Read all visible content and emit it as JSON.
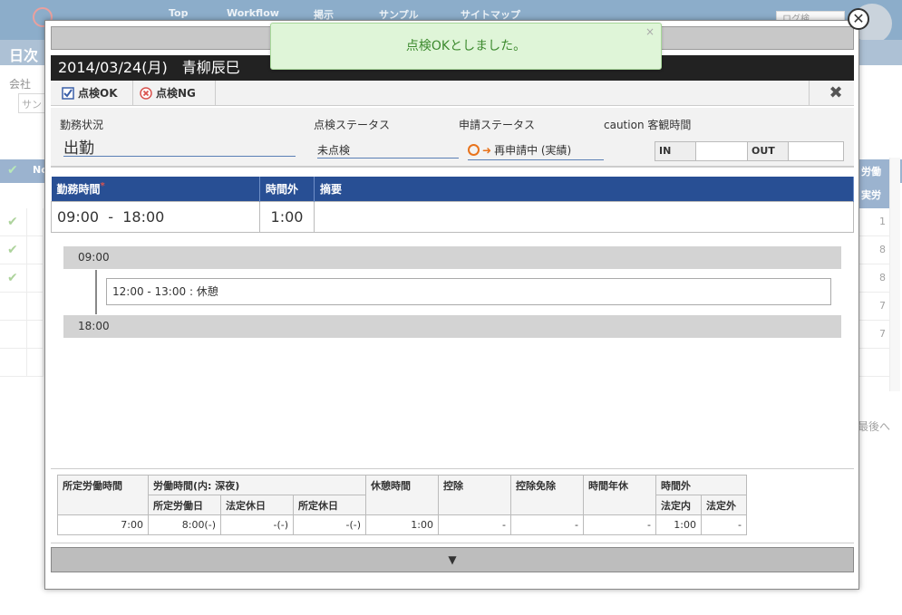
{
  "background": {
    "nav_items": [
      "Top",
      "Workflow",
      "掲示",
      "サンプル",
      "サイトマップ"
    ],
    "search_label": "ログ検",
    "page_title": "日次",
    "company_label": "会社",
    "company_value": "サン",
    "table_no_header": "No",
    "right_header_1": "労働",
    "right_header_2": "実労",
    "right_values": [
      "1",
      "8",
      "8",
      "7",
      "7",
      ""
    ],
    "last_link": "最後へ"
  },
  "toast": {
    "message": "点検OKとしました。",
    "close_label": "×"
  },
  "modal": {
    "title": "2014/03/24(月)　青柳辰巳",
    "toolbar": {
      "ok_label": "点検OK",
      "ng_label": "点検NG",
      "close_label": "✖"
    },
    "status": {
      "work_status_label": "勤務状況",
      "work_status_value": "出勤",
      "inspect_status_label": "点検ステータス",
      "inspect_status_value": "未点検",
      "apply_status_label": "申請ステータス",
      "apply_status_value": "再申請中 (実績)",
      "objective_time_label": "caution 客観時間",
      "in_label": "IN",
      "in_value": "",
      "out_label": "OUT",
      "out_value": ""
    },
    "worktime": {
      "col_worktime": "勤務時間",
      "required_mark": "*",
      "col_overtime": "時間外",
      "col_summary": "摘要",
      "start": "09:00",
      "sep": "-",
      "end": "18:00",
      "overtime": "1:00",
      "summary": ""
    },
    "timeline": {
      "start": "09:00",
      "break": "12:00 - 13:00 : 休憩",
      "end": "18:00"
    },
    "summary": {
      "h_scheduled": "所定労働時間",
      "h_worktime": "労働時間(内: 深夜)",
      "h_sched_day": "所定労働日",
      "h_legal_holiday": "法定休日",
      "h_sched_holiday": "所定休日",
      "h_break": "休憩時間",
      "h_deduct": "控除",
      "h_deduct_exempt": "控除免除",
      "h_hourly_leave": "時間年休",
      "h_overtime": "時間外",
      "h_legal_in": "法定内",
      "h_legal_out": "法定外",
      "v_scheduled": "7:00",
      "v_sched_day": "8:00(-)",
      "v_legal_holiday": "-(-)",
      "v_sched_holiday": "-(-)",
      "v_break": "1:00",
      "v_deduct": "-",
      "v_deduct_exempt": "-",
      "v_hourly_leave": "-",
      "v_legal_in": "1:00",
      "v_legal_out": "-"
    },
    "bottom_toggle": "▼",
    "close_label": "✕"
  }
}
